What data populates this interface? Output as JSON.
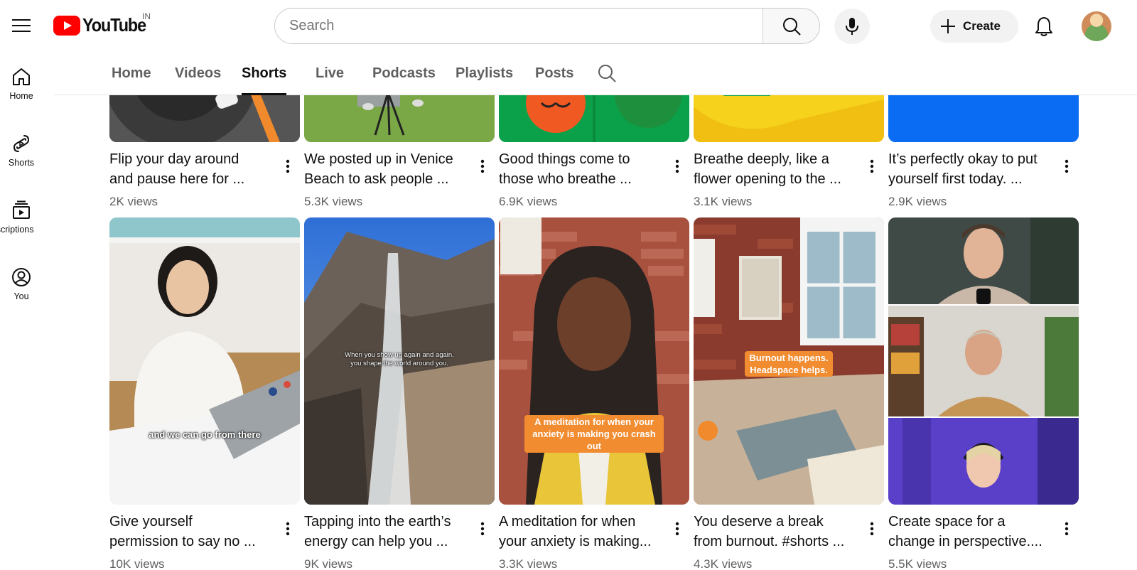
{
  "masthead": {
    "logo_text": "YouTube",
    "country_code": "IN",
    "search_placeholder": "Search",
    "create_label": "Create"
  },
  "guide": {
    "items": [
      {
        "label": "Home",
        "icon": "home-icon"
      },
      {
        "label": "Shorts",
        "icon": "shorts-icon"
      },
      {
        "label": "Subscriptions",
        "icon": "subscriptions-icon"
      },
      {
        "label": "You",
        "icon": "you-icon"
      }
    ]
  },
  "tabs": [
    {
      "label": "Home"
    },
    {
      "label": "Videos"
    },
    {
      "label": "Shorts",
      "active": true
    },
    {
      "label": "Live"
    },
    {
      "label": "Podcasts"
    },
    {
      "label": "Playlists"
    },
    {
      "label": "Posts"
    }
  ],
  "shorts_row1": [
    {
      "title_line1": "Flip your day around",
      "title_line2": "and pause here for ...",
      "views": "2K views"
    },
    {
      "title_line1": "We posted up in Venice",
      "title_line2": "Beach to ask people ...",
      "views": "5.3K views"
    },
    {
      "title_line1": "Good things come to",
      "title_line2": "those who breathe ...",
      "views": "6.9K views"
    },
    {
      "title_line1": "Breathe deeply, like a",
      "title_line2": "flower opening to the ...",
      "views": "3.1K views"
    },
    {
      "title_line1": "It’s perfectly okay to put",
      "title_line2": "yourself first today. ...",
      "views": "2.9K views"
    }
  ],
  "shorts_row2": [
    {
      "title_line1": "Give yourself",
      "title_line2": "permission to say no ...",
      "views": "10K views",
      "caption": "and we can go from there"
    },
    {
      "title_line1": "Tapping into the earth’s",
      "title_line2": "energy can help you ...",
      "views": "9K views",
      "caption_line1": "When you show up again and again,",
      "caption_line2": "you shape the world around you."
    },
    {
      "title_line1": "A meditation for when",
      "title_line2": "your anxiety is making...",
      "views": "3.3K views",
      "caption_line1": "A meditation for when your",
      "caption_line2": "anxiety is making you crash out"
    },
    {
      "title_line1": "You deserve a break",
      "title_line2": "from burnout. #shorts ...",
      "views": "4.3K views",
      "caption_line1": "Burnout happens.",
      "caption_line2": "Headspace helps."
    },
    {
      "title_line1": "Create space for a",
      "title_line2": "change in perspective....",
      "views": "5.5K views"
    }
  ],
  "colors": {
    "youtube_red": "#ff0000",
    "caption_orange": "#f28c30",
    "headspace_green": "#0aa14a",
    "headspace_yellow": "#f6d21c",
    "headspace_blue": "#0a6cf2"
  }
}
